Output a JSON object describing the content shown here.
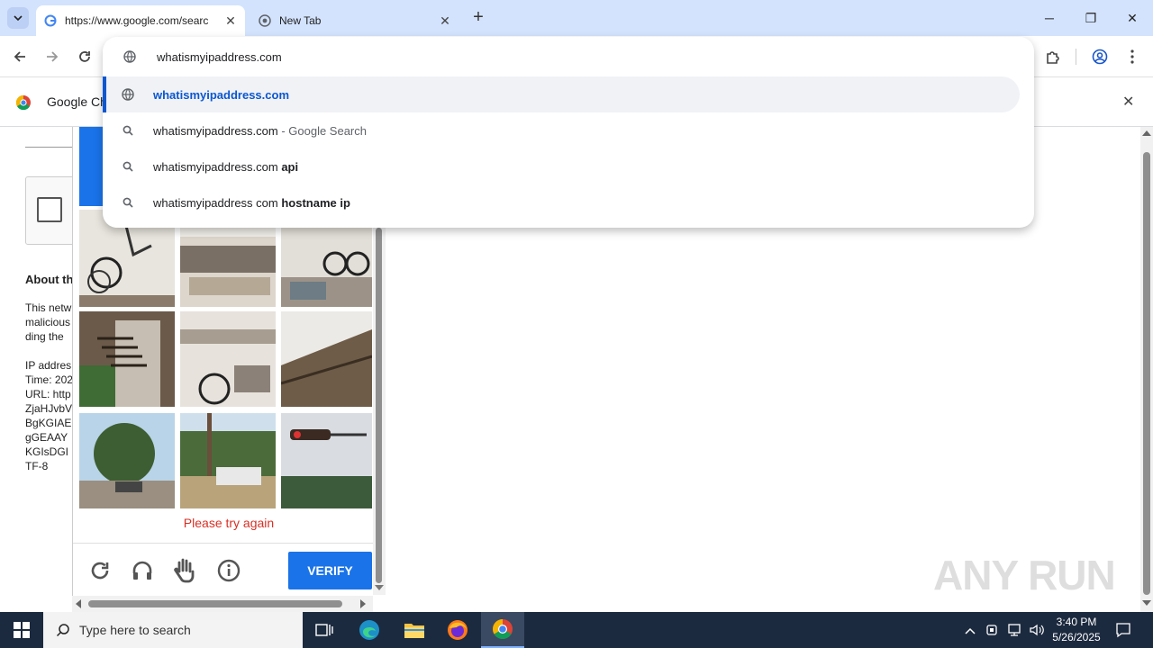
{
  "browser": {
    "tabs": [
      {
        "title": "https://www.google.com/searc",
        "active": true
      },
      {
        "title": "New Tab",
        "active": false
      }
    ],
    "new_tab_label": "+",
    "window_controls": {
      "minimize": "─",
      "restore": "❐",
      "close": "✕"
    }
  },
  "omnibox": {
    "input_value": "whatismyipaddress.com",
    "suggestions": [
      {
        "icon": "globe-icon",
        "text": "whatismyipaddress.com",
        "bold": "",
        "suffix": ""
      },
      {
        "icon": "search-icon",
        "text": "whatismyipaddress.com",
        "bold": "",
        "suffix": " - Google Search"
      },
      {
        "icon": "search-icon",
        "text": "whatismyipaddress.com ",
        "bold": "api",
        "suffix": ""
      },
      {
        "icon": "search-icon",
        "text": "whatismyipaddress com ",
        "bold": "hostname ip",
        "suffix": ""
      }
    ]
  },
  "infobar": {
    "text": "Google Ch"
  },
  "left_page": {
    "lines": [
      "About th",
      "This netw",
      "malicious",
      "ding the",
      "IP addres",
      "Time: 202",
      "URL: http",
      "ZjaHJvbV",
      "BgKGIAE",
      "gGEAAY",
      "KGIsDGI",
      "TF-8"
    ]
  },
  "captcha": {
    "error_text": "Please try again",
    "verify_label": "VERIFY"
  },
  "taskbar": {
    "search_placeholder": "Type here to search",
    "time": "3:40 PM",
    "date": "5/26/2025"
  },
  "watermark": "ANY RUN"
}
